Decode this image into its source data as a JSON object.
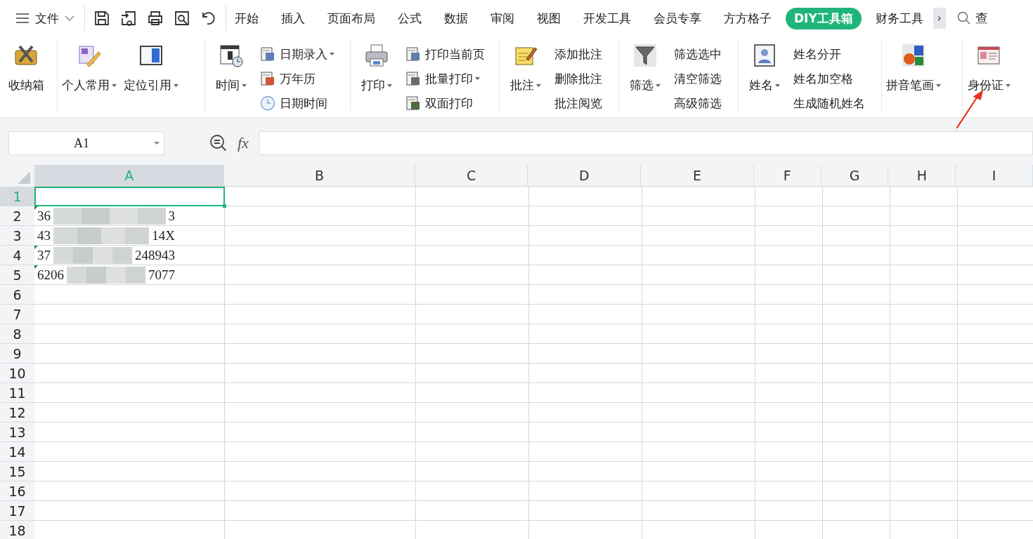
{
  "menu": {
    "label": "文件"
  },
  "tabs": [
    {
      "label": "开始",
      "selected": false
    },
    {
      "label": "插入",
      "selected": false
    },
    {
      "label": "页面布局",
      "selected": false
    },
    {
      "label": "公式",
      "selected": false
    },
    {
      "label": "数据",
      "selected": false
    },
    {
      "label": "审阅",
      "selected": false
    },
    {
      "label": "视图",
      "selected": false
    },
    {
      "label": "开发工具",
      "selected": false
    },
    {
      "label": "会员专享",
      "selected": false
    },
    {
      "label": "方方格子",
      "selected": false
    },
    {
      "label": "DIY工具箱",
      "selected": true
    },
    {
      "label": "财务工具",
      "selected": false
    }
  ],
  "more_tabs": "›",
  "search": {
    "placeholder": "查"
  },
  "ribbon": [
    {
      "large": [
        {
          "label": "收纳箱",
          "dropdown": false
        }
      ]
    },
    {
      "large": [
        {
          "label": "个人常用",
          "dropdown": true
        },
        {
          "label": "定位引用",
          "dropdown": true
        }
      ]
    },
    {
      "large": [
        {
          "label": "时间",
          "dropdown": true
        }
      ],
      "small": [
        {
          "label": "日期录入",
          "dropdown": true,
          "kind": "icon"
        },
        {
          "label": "万年历",
          "dropdown": false,
          "kind": "icon"
        },
        {
          "label": "日期时间",
          "dropdown": false,
          "kind": "icon"
        }
      ]
    },
    {
      "large": [
        {
          "label": "打印",
          "dropdown": true
        }
      ],
      "small": [
        {
          "label": "打印当前页",
          "dropdown": false,
          "kind": "icon"
        },
        {
          "label": "批量打印",
          "dropdown": true,
          "kind": "icon"
        },
        {
          "label": "双面打印",
          "dropdown": false,
          "kind": "icon"
        }
      ]
    },
    {
      "large": [
        {
          "label": "批注",
          "dropdown": true
        }
      ],
      "small": [
        {
          "label": "添加批注",
          "dropdown": false,
          "kind": "plain"
        },
        {
          "label": "删除批注",
          "dropdown": false,
          "kind": "plain"
        },
        {
          "label": "批注阅览",
          "dropdown": false,
          "kind": "plain"
        }
      ]
    },
    {
      "large": [
        {
          "label": "筛选",
          "dropdown": true
        }
      ],
      "small": [
        {
          "label": "筛选选中",
          "dropdown": false,
          "kind": "plain"
        },
        {
          "label": "清空筛选",
          "dropdown": false,
          "kind": "plain"
        },
        {
          "label": "高级筛选",
          "dropdown": false,
          "kind": "plain"
        }
      ]
    },
    {
      "large": [
        {
          "label": "姓名",
          "dropdown": true
        }
      ],
      "small": [
        {
          "label": "姓名分开",
          "dropdown": false,
          "kind": "plain"
        },
        {
          "label": "姓名加空格",
          "dropdown": false,
          "kind": "plain"
        },
        {
          "label": "生成随机姓名",
          "dropdown": false,
          "kind": "plain"
        }
      ]
    },
    {
      "large": [
        {
          "label": "拼音笔画",
          "dropdown": true
        }
      ]
    },
    {
      "large": [
        {
          "label": "身份证",
          "dropdown": true
        }
      ]
    }
  ],
  "name_box": {
    "value": "A1"
  },
  "formula_label": "fx",
  "columns": [
    {
      "label": "A",
      "selected": true
    },
    {
      "label": "B",
      "selected": false
    },
    {
      "label": "C",
      "selected": false
    },
    {
      "label": "D",
      "selected": false
    },
    {
      "label": "E",
      "selected": false
    },
    {
      "label": "F",
      "selected": false
    },
    {
      "label": "G",
      "selected": false
    },
    {
      "label": "H",
      "selected": false
    },
    {
      "label": "I",
      "selected": false
    }
  ],
  "rows": [
    {
      "label": "1",
      "selected": true
    },
    {
      "label": "2",
      "selected": false,
      "cells": [
        {
          "parts": [
            "36",
            "3"
          ],
          "flagged": true
        }
      ]
    },
    {
      "label": "3",
      "selected": false,
      "cells": [
        {
          "parts": [
            "43",
            "14X"
          ],
          "flagged": false
        }
      ]
    },
    {
      "label": "4",
      "selected": false,
      "cells": [
        {
          "parts": [
            "37",
            "248943"
          ],
          "flagged": true
        }
      ]
    },
    {
      "label": "5",
      "selected": false,
      "cells": [
        {
          "parts": [
            "6206",
            "7077"
          ],
          "flagged": true
        }
      ]
    },
    {
      "label": "6",
      "selected": false
    },
    {
      "label": "7",
      "selected": false
    },
    {
      "label": "8",
      "selected": false
    },
    {
      "label": "9",
      "selected": false
    },
    {
      "label": "10",
      "selected": false
    },
    {
      "label": "11",
      "selected": false
    },
    {
      "label": "12",
      "selected": false
    },
    {
      "label": "13",
      "selected": false
    },
    {
      "label": "14",
      "selected": false
    },
    {
      "label": "15",
      "selected": false
    },
    {
      "label": "16",
      "selected": false
    },
    {
      "label": "17",
      "selected": false
    },
    {
      "label": "18",
      "selected": false
    }
  ]
}
